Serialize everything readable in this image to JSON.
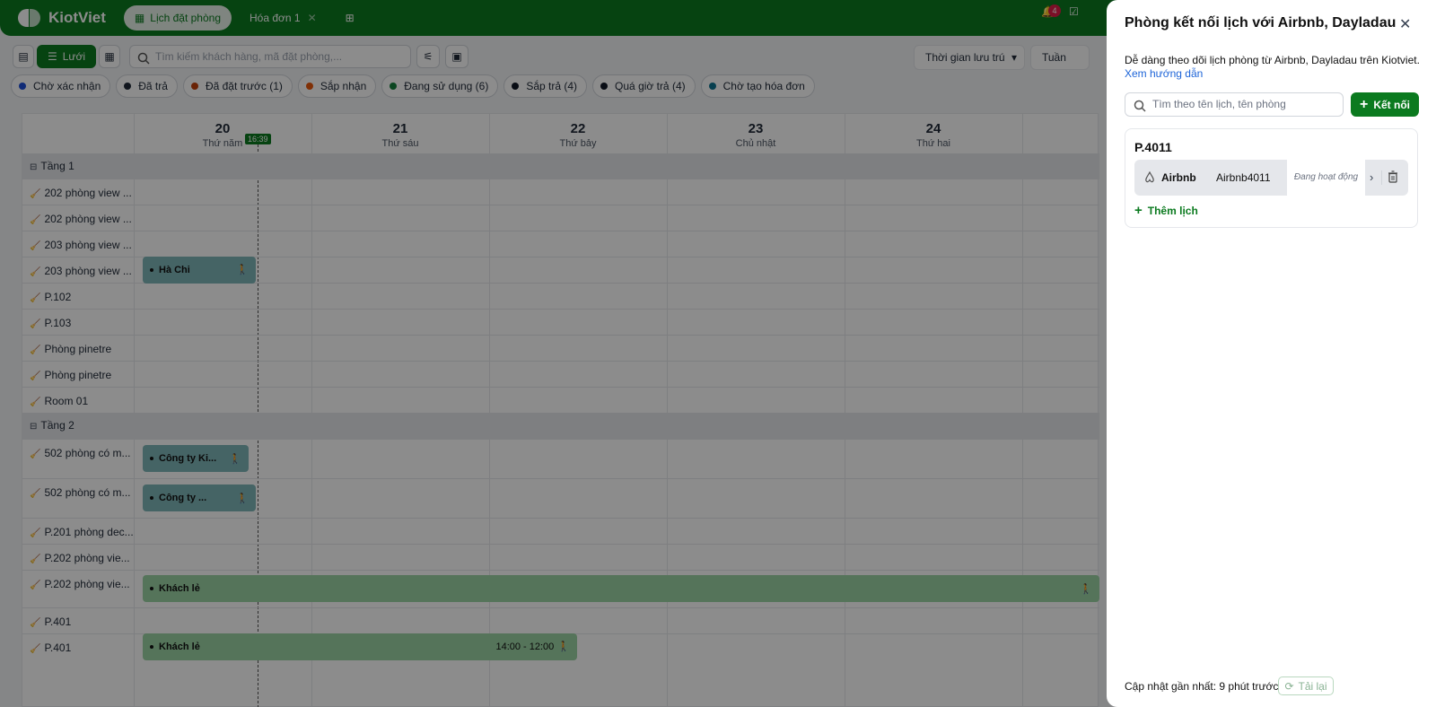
{
  "topbar": {
    "brand": "KiotViet",
    "tabs": [
      {
        "label": "Lịch đặt phòng",
        "active": true
      },
      {
        "label": "Hóa đơn 1",
        "active": false
      }
    ],
    "notification_count": "4",
    "accent_color": "#0b7a1f"
  },
  "toolbar": {
    "view_grid_label": "Lưới",
    "search_placeholder": "Tìm kiếm khách hàng, mã đặt phòng,...",
    "time_filter": "Thời gian lưu trú",
    "period": "Tuần"
  },
  "chips": [
    {
      "label": "Chờ xác nhận",
      "color": "#1d4ed8"
    },
    {
      "label": "Đã trả",
      "color": "#1f2937"
    },
    {
      "label": "Đã đặt trước (1)",
      "color": "#c2410c"
    },
    {
      "label": "Sắp nhận",
      "color": "#ea580c"
    },
    {
      "label": "Đang sử dụng (6)",
      "color": "#15803d"
    },
    {
      "label": "Sắp trả (4)",
      "color": "#111827"
    },
    {
      "label": "Quá giờ trả (4)",
      "color": "#111827"
    },
    {
      "label": "Chờ tạo hóa đơn",
      "color": "#0e7490"
    }
  ],
  "calendar": {
    "now_time": "16:39",
    "days": [
      {
        "num": "20",
        "weekday": "Thứ năm"
      },
      {
        "num": "21",
        "weekday": "Thứ sáu"
      },
      {
        "num": "22",
        "weekday": "Thứ bảy"
      },
      {
        "num": "23",
        "weekday": "Chủ nhật"
      },
      {
        "num": "24",
        "weekday": "Thứ hai"
      }
    ],
    "rows": [
      {
        "label": "Tầng 1",
        "floor": true
      },
      {
        "label": "202 phòng view ..."
      },
      {
        "label": "202 phòng view ..."
      },
      {
        "label": "203 phòng view ..."
      },
      {
        "label": "203 phòng view ..."
      },
      {
        "label": "P.102"
      },
      {
        "label": "P.103"
      },
      {
        "label": "Phòng pinetre"
      },
      {
        "label": "Phòng pinetre"
      },
      {
        "label": "Room 01"
      },
      {
        "label": "Tầng 2",
        "floor": true
      },
      {
        "label": "502 phòng có m..."
      },
      {
        "label": "502 phòng có m..."
      },
      {
        "label": "P.201 phòng dec..."
      },
      {
        "label": "P.202 phòng vie..."
      },
      {
        "label": "P.202 phòng vie..."
      },
      {
        "label": "P.401"
      },
      {
        "label": "P.401"
      }
    ],
    "bookings": [
      {
        "name": "Hà Chi"
      },
      {
        "name": "Công ty Ki..."
      },
      {
        "name": "Công ty ..."
      },
      {
        "name": "Khách lẻ"
      },
      {
        "name": "Khách lẻ",
        "time": "14:00 - 12:00"
      }
    ]
  },
  "panel": {
    "title": "Phòng kết nối lịch với Airbnb, Dayladau",
    "description": "Dễ dàng theo dõi lịch phòng từ Airbnb, Dayladau trên Kiotviet.",
    "guide_link": "Xem hướng dẫn",
    "search_placeholder": "Tìm theo tên lịch, tên phòng",
    "connect_label": "Kết nối",
    "room": {
      "name": "P.4011",
      "source": "Airbnb",
      "calendar_name": "Airbnb4011",
      "status": "Đang hoạt động"
    },
    "add_calendar_label": "Thêm lịch",
    "last_updated": "Cập nhật gần nhất: 9 phút trước",
    "reload_label": "Tải lại"
  }
}
